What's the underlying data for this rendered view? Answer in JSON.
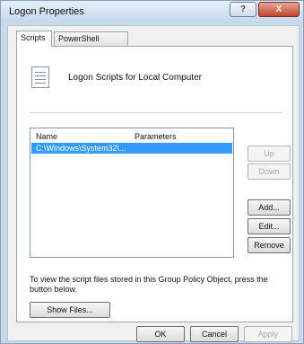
{
  "window": {
    "title": "Logon Properties",
    "help_label": "?",
    "close_label": "X"
  },
  "tabs": [
    {
      "label": "Scripts",
      "active": true
    },
    {
      "label": "PowerShell Scripts",
      "active": false
    }
  ],
  "heading": "Logon Scripts for Local Computer",
  "list": {
    "columns": [
      "Name",
      "Parameters"
    ],
    "rows": [
      {
        "name": "C:\\Windows\\System32\\...",
        "parameters": "",
        "selected": true
      }
    ]
  },
  "side_buttons": {
    "up": "Up",
    "down": "Down",
    "add": "Add...",
    "edit": "Edit...",
    "remove": "Remove"
  },
  "info_text": "To view the script files stored in this Group Policy Object, press the button below.",
  "show_files_label": "Show Files...",
  "footer": {
    "ok": "OK",
    "cancel": "Cancel",
    "apply": "Apply"
  },
  "colors": {
    "selection": "#3399ff",
    "close_button": "#c3452f"
  }
}
